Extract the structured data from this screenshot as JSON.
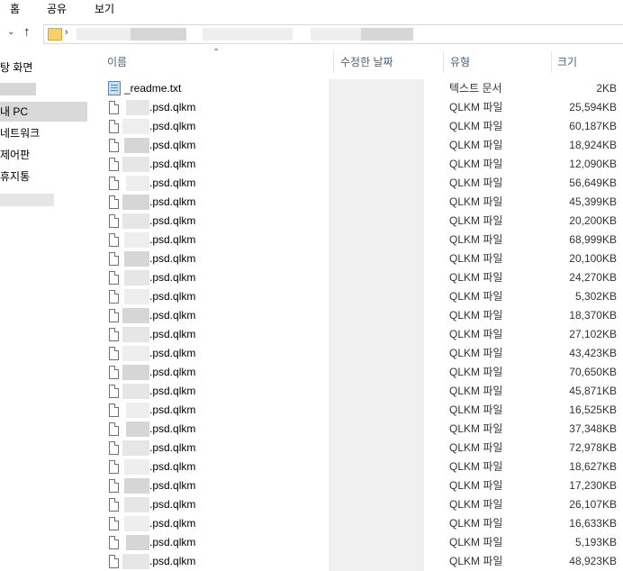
{
  "ribbon": {
    "tabs": [
      "홈",
      "공유",
      "보기"
    ]
  },
  "nav": {
    "items": [
      "탕 화면",
      "",
      "내 PC",
      "네트워크",
      "제어판",
      "휴지통",
      ""
    ]
  },
  "columns": {
    "name": "이름",
    "date": "수정한 날짜",
    "type": "유형",
    "size": "크기"
  },
  "files": [
    {
      "name": "_readme.txt",
      "type": "텍스트 문서",
      "size": "2KB",
      "icon": "text-file-icon"
    },
    {
      "name": ".psd.qlkm",
      "type": "QLKM 파일",
      "size": "25,594KB",
      "icon": "file-icon"
    },
    {
      "name": ".psd.qlkm",
      "type": "QLKM 파일",
      "size": "60,187KB",
      "icon": "file-icon"
    },
    {
      "name": ".psd.qlkm",
      "type": "QLKM 파일",
      "size": "18,924KB",
      "icon": "file-icon"
    },
    {
      "name": ".psd.qlkm",
      "type": "QLKM 파일",
      "size": "12,090KB",
      "icon": "file-icon"
    },
    {
      "name": ".psd.qlkm",
      "type": "QLKM 파일",
      "size": "56,649KB",
      "icon": "file-icon"
    },
    {
      "name": ".psd.qlkm",
      "type": "QLKM 파일",
      "size": "45,399KB",
      "icon": "file-icon"
    },
    {
      "name": ".psd.qlkm",
      "type": "QLKM 파일",
      "size": "20,200KB",
      "icon": "file-icon"
    },
    {
      "name": ".psd.qlkm",
      "type": "QLKM 파일",
      "size": "68,999KB",
      "icon": "file-icon"
    },
    {
      "name": ".psd.qlkm",
      "type": "QLKM 파일",
      "size": "20,100KB",
      "icon": "file-icon"
    },
    {
      "name": ".psd.qlkm",
      "type": "QLKM 파일",
      "size": "24,270KB",
      "icon": "file-icon"
    },
    {
      "name": ".psd.qlkm",
      "type": "QLKM 파일",
      "size": "5,302KB",
      "icon": "file-icon"
    },
    {
      "name": ".psd.qlkm",
      "type": "QLKM 파일",
      "size": "18,370KB",
      "icon": "file-icon"
    },
    {
      "name": ".psd.qlkm",
      "type": "QLKM 파일",
      "size": "27,102KB",
      "icon": "file-icon"
    },
    {
      "name": ".psd.qlkm",
      "type": "QLKM 파일",
      "size": "43,423KB",
      "icon": "file-icon"
    },
    {
      "name": ".psd.qlkm",
      "type": "QLKM 파일",
      "size": "70,650KB",
      "icon": "file-icon"
    },
    {
      "name": ".psd.qlkm",
      "type": "QLKM 파일",
      "size": "45,871KB",
      "icon": "file-icon"
    },
    {
      "name": ".psd.qlkm",
      "type": "QLKM 파일",
      "size": "16,525KB",
      "icon": "file-icon"
    },
    {
      "name": ".psd.qlkm",
      "type": "QLKM 파일",
      "size": "37,348KB",
      "icon": "file-icon"
    },
    {
      "name": ".psd.qlkm",
      "type": "QLKM 파일",
      "size": "72,978KB",
      "icon": "file-icon"
    },
    {
      "name": ".psd.qlkm",
      "type": "QLKM 파일",
      "size": "18,627KB",
      "icon": "file-icon"
    },
    {
      "name": ".psd.qlkm",
      "type": "QLKM 파일",
      "size": "17,230KB",
      "icon": "file-icon"
    },
    {
      "name": ".psd.qlkm",
      "type": "QLKM 파일",
      "size": "26,107KB",
      "icon": "file-icon"
    },
    {
      "name": ".psd.qlkm",
      "type": "QLKM 파일",
      "size": "16,633KB",
      "icon": "file-icon"
    },
    {
      "name": ".psd.qlkm",
      "type": "QLKM 파일",
      "size": "5,193KB",
      "icon": "file-icon"
    },
    {
      "name": ".psd.qlkm",
      "type": "QLKM 파일",
      "size": "48,923KB",
      "icon": "file-icon"
    }
  ]
}
